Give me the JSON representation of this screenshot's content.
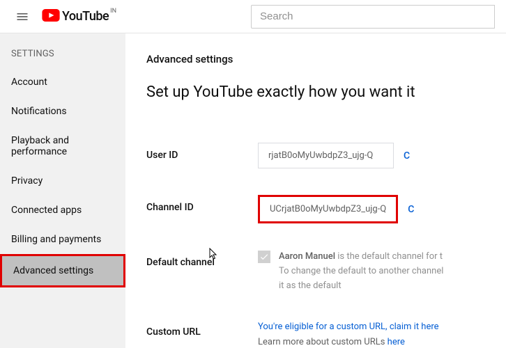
{
  "header": {
    "brand": "YouTube",
    "country": "IN",
    "search_placeholder": "Search"
  },
  "sidebar": {
    "heading": "SETTINGS",
    "items": [
      {
        "label": "Account"
      },
      {
        "label": "Notifications"
      },
      {
        "label": "Playback and performance"
      },
      {
        "label": "Privacy"
      },
      {
        "label": "Connected apps"
      },
      {
        "label": "Billing and payments"
      },
      {
        "label": "Advanced settings"
      }
    ]
  },
  "main": {
    "title": "Advanced settings",
    "subtitle": "Set up YouTube exactly how you want it",
    "user_id": {
      "label": "User ID",
      "value": "rjatB0oMyUwbdpZ3_ujg-Q",
      "copy": "C"
    },
    "channel_id": {
      "label": "Channel ID",
      "value": "UCrjatB0oMyUwbdpZ3_ujg-Q",
      "copy": "C"
    },
    "default_channel": {
      "label": "Default channel",
      "name": "Aaron Manuel",
      "text1": " is the default channel for t",
      "text2": "To change the default to another channel",
      "text3": "it as the default"
    },
    "custom_url": {
      "label": "Custom URL",
      "line1": "You're eligible for a custom URL, claim it here",
      "line2a": "Learn more about custom URLs ",
      "line2b": "here"
    }
  }
}
